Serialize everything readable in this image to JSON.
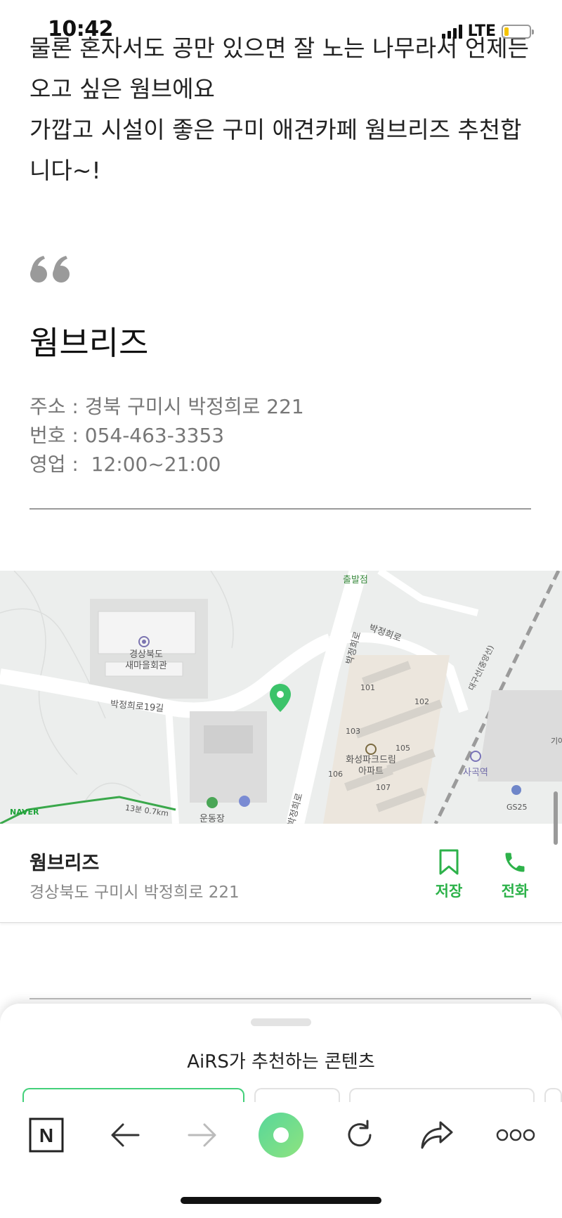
{
  "status_bar": {
    "time": "10:42",
    "network": "LTE"
  },
  "article": {
    "paragraphs": [
      "물론 혼자서도 공만 있으면 잘 노는 나무라서 언제든",
      "오고 싶은 웜브에요",
      "가깝고 시설이 좋은 구미 애견카페 웜브리즈 추천합",
      "니다~!"
    ],
    "place_name": "웜브리즈",
    "info": [
      "주소 : 경북 구미시 박정희로 221",
      "번호 : 054-463-3353",
      "영업 :  12:00~21:00"
    ]
  },
  "map": {
    "labels": {
      "start_point": "출발점",
      "road_1": "박정희로",
      "road_2": "박정희로",
      "road_3": "박정희로19길",
      "road_4": "박정희로",
      "building": "경상북도\n새마을회관",
      "apartment": "화성파크드림\n아파트",
      "station": "사곡역",
      "gs25": "GS25",
      "stadium": "운동장",
      "dong_101": "101",
      "dong_102": "102",
      "dong_103": "103",
      "dong_105": "105",
      "dong_106": "106",
      "dong_107": "107",
      "route_time": "13분 0.7km",
      "rail": "대구선(중앙선)",
      "edge_text": "기아"
    },
    "logo": "NAVER",
    "route_color": "#3aa84b",
    "pin_color": "#3cc36a"
  },
  "place_card": {
    "name": "웜브리즈",
    "address": "경상북도 구미시 박정희로 221",
    "save_label": "저장",
    "call_label": "전화",
    "accent_color": "#2db24a"
  },
  "recommend_sheet": {
    "title": "AiRS가 추천하는 콘텐츠"
  },
  "toolbar": {
    "icons": [
      "naver-home-icon",
      "back-arrow-icon",
      "forward-arrow-icon",
      "green-dot-icon",
      "refresh-icon",
      "share-icon",
      "more-icon"
    ],
    "home_label": "N"
  }
}
